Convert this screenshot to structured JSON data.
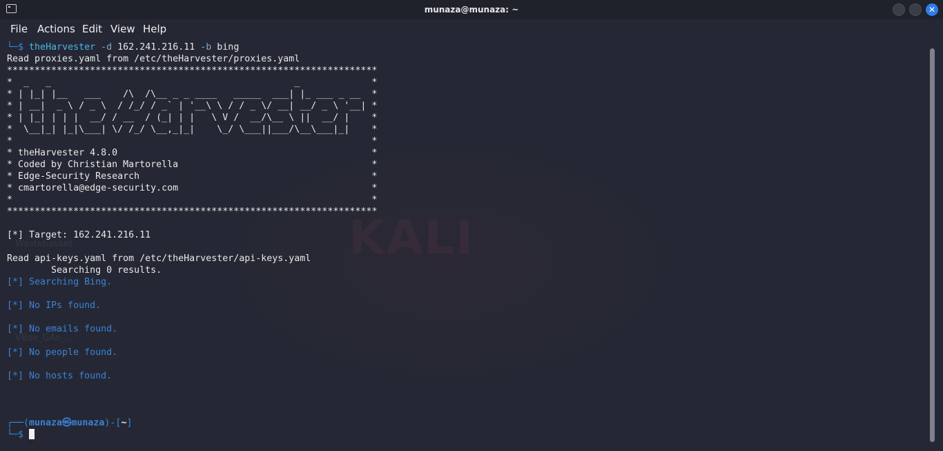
{
  "window": {
    "title": "munaza@munaza: ~"
  },
  "menu": [
    "File",
    "Actions",
    "Edit",
    "View",
    "Help"
  ],
  "command": {
    "prompt_symbol": "└─$",
    "program": "theHarvester",
    "opt_d": "-d",
    "domain": "162.241.216.11",
    "opt_b": "-b",
    "source": "bing"
  },
  "output": {
    "proxies_line": "Read proxies.yaml from /etc/theHarvester/proxies.yaml",
    "banner": [
      "*******************************************************************",
      "*  _   _                                            _             *",
      "* | |_| |__   ___    /\\  /\\__ _ _ ____   _____  ___| |_ ___ _ __  *",
      "* | __|  _ \\ / _ \\  / /_/ / _` | '__\\ \\ / / _ \\/ __| __/ _ \\ '__| *",
      "* | |_| | | |  __/ / __  / (_| | |   \\ V /  __/\\__ \\ ||  __/ |    *",
      "*  \\__|_| |_|\\___| \\/ /_/ \\__,_|_|    \\_/ \\___||___/\\__\\___|_|    *",
      "*                                                                 *",
      "* theHarvester 4.8.0                                              *",
      "* Coded by Christian Martorella                                   *",
      "* Edge-Security Research                                          *",
      "* cmartorella@edge-security.com                                   *",
      "*                                                                 *",
      "*******************************************************************"
    ],
    "target_line": "[*] Target: 162.241.216.11",
    "api_keys_line": "Read api-keys.yaml from /etc/theHarvester/api-keys.yaml",
    "searching_line": "        Searching 0 results.",
    "searching_bing": "[*] Searching Bing.",
    "no_ips": "[*] No IPs found.",
    "no_emails": "[*] No emails found.",
    "no_people": "[*] No people found.",
    "no_hosts": "[*] No hosts found."
  },
  "prompt": {
    "top_left": "┌──(",
    "user": "munaza",
    "at_symbol": "㉿",
    "host": "munaza",
    "mid": ")-[",
    "dir": "~",
    "end": "]",
    "bottom": "└─$"
  },
  "desktop": {
    "watermark_text": "KALI",
    "icon_label_1": "Wastebasket",
    "icon_label_2": "VBox_GAs_..."
  },
  "colors": {
    "background": "#252834",
    "accent": "#2f7de6",
    "info_text": "#3b82d6"
  }
}
